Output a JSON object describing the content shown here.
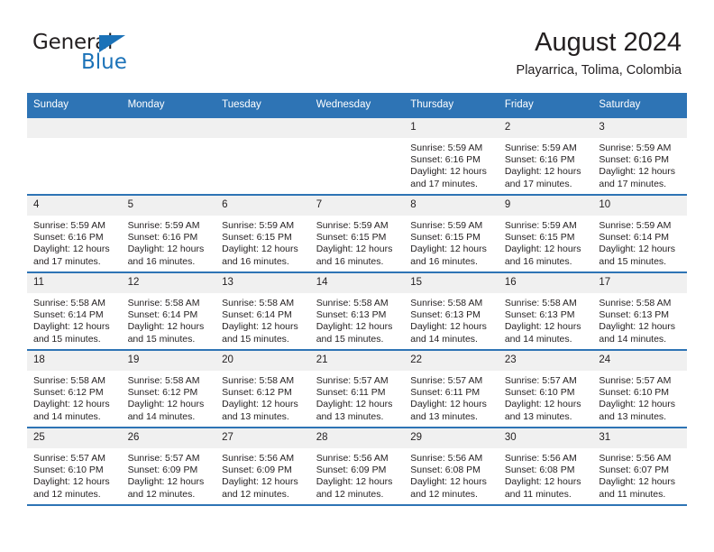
{
  "brand": {
    "name_part1": "General",
    "name_part2": "Blue",
    "triangle_color": "#1b72b8",
    "text_color": "#231f20"
  },
  "header": {
    "title": "August 2024",
    "subtitle": "Playarrica, Tolima, Colombia"
  },
  "theme": {
    "accent": "#2e74b5",
    "daynum_background": "#f0f0f0",
    "text": "#231f20"
  },
  "calendar": {
    "weekday_headers": [
      "Sunday",
      "Monday",
      "Tuesday",
      "Wednesday",
      "Thursday",
      "Friday",
      "Saturday"
    ],
    "labels": {
      "sunrise": "Sunrise:",
      "sunset": "Sunset:",
      "daylight": "Daylight:"
    },
    "weeks": [
      [
        {
          "day": "",
          "empty": true
        },
        {
          "day": "",
          "empty": true
        },
        {
          "day": "",
          "empty": true
        },
        {
          "day": "",
          "empty": true
        },
        {
          "day": "1",
          "sunrise": "Sunrise: 5:59 AM",
          "sunset": "Sunset: 6:16 PM",
          "daylight": "Daylight: 12 hours and 17 minutes."
        },
        {
          "day": "2",
          "sunrise": "Sunrise: 5:59 AM",
          "sunset": "Sunset: 6:16 PM",
          "daylight": "Daylight: 12 hours and 17 minutes."
        },
        {
          "day": "3",
          "sunrise": "Sunrise: 5:59 AM",
          "sunset": "Sunset: 6:16 PM",
          "daylight": "Daylight: 12 hours and 17 minutes."
        }
      ],
      [
        {
          "day": "4",
          "sunrise": "Sunrise: 5:59 AM",
          "sunset": "Sunset: 6:16 PM",
          "daylight": "Daylight: 12 hours and 17 minutes."
        },
        {
          "day": "5",
          "sunrise": "Sunrise: 5:59 AM",
          "sunset": "Sunset: 6:16 PM",
          "daylight": "Daylight: 12 hours and 16 minutes."
        },
        {
          "day": "6",
          "sunrise": "Sunrise: 5:59 AM",
          "sunset": "Sunset: 6:15 PM",
          "daylight": "Daylight: 12 hours and 16 minutes."
        },
        {
          "day": "7",
          "sunrise": "Sunrise: 5:59 AM",
          "sunset": "Sunset: 6:15 PM",
          "daylight": "Daylight: 12 hours and 16 minutes."
        },
        {
          "day": "8",
          "sunrise": "Sunrise: 5:59 AM",
          "sunset": "Sunset: 6:15 PM",
          "daylight": "Daylight: 12 hours and 16 minutes."
        },
        {
          "day": "9",
          "sunrise": "Sunrise: 5:59 AM",
          "sunset": "Sunset: 6:15 PM",
          "daylight": "Daylight: 12 hours and 16 minutes."
        },
        {
          "day": "10",
          "sunrise": "Sunrise: 5:59 AM",
          "sunset": "Sunset: 6:14 PM",
          "daylight": "Daylight: 12 hours and 15 minutes."
        }
      ],
      [
        {
          "day": "11",
          "sunrise": "Sunrise: 5:58 AM",
          "sunset": "Sunset: 6:14 PM",
          "daylight": "Daylight: 12 hours and 15 minutes."
        },
        {
          "day": "12",
          "sunrise": "Sunrise: 5:58 AM",
          "sunset": "Sunset: 6:14 PM",
          "daylight": "Daylight: 12 hours and 15 minutes."
        },
        {
          "day": "13",
          "sunrise": "Sunrise: 5:58 AM",
          "sunset": "Sunset: 6:14 PM",
          "daylight": "Daylight: 12 hours and 15 minutes."
        },
        {
          "day": "14",
          "sunrise": "Sunrise: 5:58 AM",
          "sunset": "Sunset: 6:13 PM",
          "daylight": "Daylight: 12 hours and 15 minutes."
        },
        {
          "day": "15",
          "sunrise": "Sunrise: 5:58 AM",
          "sunset": "Sunset: 6:13 PM",
          "daylight": "Daylight: 12 hours and 14 minutes."
        },
        {
          "day": "16",
          "sunrise": "Sunrise: 5:58 AM",
          "sunset": "Sunset: 6:13 PM",
          "daylight": "Daylight: 12 hours and 14 minutes."
        },
        {
          "day": "17",
          "sunrise": "Sunrise: 5:58 AM",
          "sunset": "Sunset: 6:13 PM",
          "daylight": "Daylight: 12 hours and 14 minutes."
        }
      ],
      [
        {
          "day": "18",
          "sunrise": "Sunrise: 5:58 AM",
          "sunset": "Sunset: 6:12 PM",
          "daylight": "Daylight: 12 hours and 14 minutes."
        },
        {
          "day": "19",
          "sunrise": "Sunrise: 5:58 AM",
          "sunset": "Sunset: 6:12 PM",
          "daylight": "Daylight: 12 hours and 14 minutes."
        },
        {
          "day": "20",
          "sunrise": "Sunrise: 5:58 AM",
          "sunset": "Sunset: 6:12 PM",
          "daylight": "Daylight: 12 hours and 13 minutes."
        },
        {
          "day": "21",
          "sunrise": "Sunrise: 5:57 AM",
          "sunset": "Sunset: 6:11 PM",
          "daylight": "Daylight: 12 hours and 13 minutes."
        },
        {
          "day": "22",
          "sunrise": "Sunrise: 5:57 AM",
          "sunset": "Sunset: 6:11 PM",
          "daylight": "Daylight: 12 hours and 13 minutes."
        },
        {
          "day": "23",
          "sunrise": "Sunrise: 5:57 AM",
          "sunset": "Sunset: 6:10 PM",
          "daylight": "Daylight: 12 hours and 13 minutes."
        },
        {
          "day": "24",
          "sunrise": "Sunrise: 5:57 AM",
          "sunset": "Sunset: 6:10 PM",
          "daylight": "Daylight: 12 hours and 13 minutes."
        }
      ],
      [
        {
          "day": "25",
          "sunrise": "Sunrise: 5:57 AM",
          "sunset": "Sunset: 6:10 PM",
          "daylight": "Daylight: 12 hours and 12 minutes."
        },
        {
          "day": "26",
          "sunrise": "Sunrise: 5:57 AM",
          "sunset": "Sunset: 6:09 PM",
          "daylight": "Daylight: 12 hours and 12 minutes."
        },
        {
          "day": "27",
          "sunrise": "Sunrise: 5:56 AM",
          "sunset": "Sunset: 6:09 PM",
          "daylight": "Daylight: 12 hours and 12 minutes."
        },
        {
          "day": "28",
          "sunrise": "Sunrise: 5:56 AM",
          "sunset": "Sunset: 6:09 PM",
          "daylight": "Daylight: 12 hours and 12 minutes."
        },
        {
          "day": "29",
          "sunrise": "Sunrise: 5:56 AM",
          "sunset": "Sunset: 6:08 PM",
          "daylight": "Daylight: 12 hours and 12 minutes."
        },
        {
          "day": "30",
          "sunrise": "Sunrise: 5:56 AM",
          "sunset": "Sunset: 6:08 PM",
          "daylight": "Daylight: 12 hours and 11 minutes."
        },
        {
          "day": "31",
          "sunrise": "Sunrise: 5:56 AM",
          "sunset": "Sunset: 6:07 PM",
          "daylight": "Daylight: 12 hours and 11 minutes."
        }
      ]
    ]
  }
}
